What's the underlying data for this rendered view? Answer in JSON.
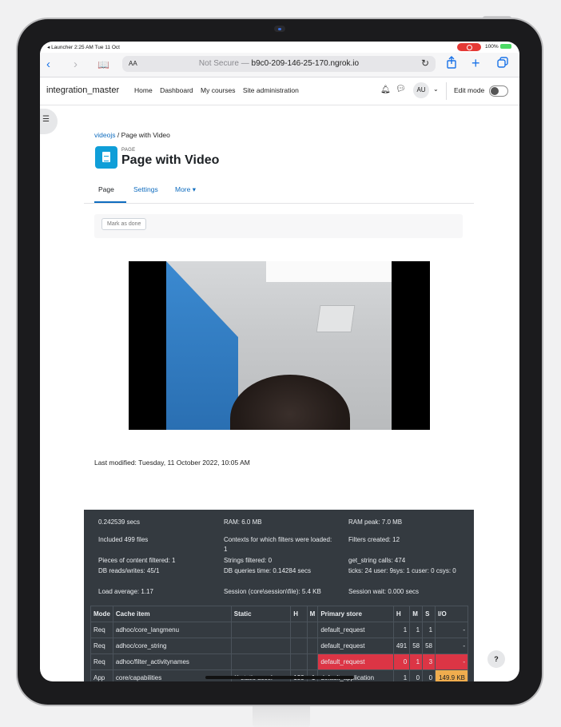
{
  "statusbar": {
    "time_info": "◂ Launcher  2:25 AM   Tue 11 Oct",
    "battery": "100%"
  },
  "browser": {
    "text_size": "AA",
    "not_secure": "Not Secure —",
    "host": "b9c0-209-146-25-170.ngrok.io",
    "icons": {
      "back": "chevron-left",
      "forward": "chevron-right",
      "bookmarks": "book",
      "reload": "refresh",
      "share": "share",
      "new_tab": "plus",
      "tabs": "tabs"
    }
  },
  "nav": {
    "site_name": "integration_master",
    "links": [
      "Home",
      "Dashboard",
      "My courses",
      "Site administration"
    ],
    "avatar_initials": "AU",
    "edit_mode": "Edit mode"
  },
  "breadcrumb": {
    "parent": "videojs",
    "separator": "/",
    "current": "Page with Video"
  },
  "page": {
    "kind": "PAGE",
    "title": "Page with Video",
    "tabs": {
      "page": "Page",
      "settings": "Settings",
      "more": "More ▾"
    },
    "mark_done": "Mark as done",
    "last_modified": "Last modified: Tuesday, 11 October 2022, 10:05 AM"
  },
  "perf": {
    "time": "0.242539 secs",
    "ram": "RAM: 6.0 MB",
    "ram_peak": "RAM peak: 7.0 MB",
    "included": "Included 499 files",
    "contexts": "Contexts for which filters were loaded: 1",
    "filters_created": "Filters created: 12",
    "pieces": "Pieces of content filtered: 1",
    "strings": "Strings filtered: 0",
    "get_string": "get_string calls: 474",
    "db_rw": "DB reads/writes: 45/1",
    "db_time": "DB queries time: 0.14284 secs",
    "ticks": "ticks: 24 user: 9sys: 1 cuser: 0 csys: 0",
    "load": "Load average: 1.17",
    "session": "Session (core\\session\\file): 5.4 KB",
    "session_wait": "Session wait: 0.000 secs"
  },
  "cache_table": {
    "headers": [
      "Mode",
      "Cache item",
      "Static",
      "H",
      "M",
      "Primary store",
      "H",
      "M",
      "S",
      "I/O"
    ],
    "rows": [
      [
        "Req",
        "adhoc/core_langmenu",
        "",
        "",
        "",
        "default_request",
        "1",
        "1",
        "1",
        "-"
      ],
      [
        "Req",
        "adhoc/core_string",
        "",
        "",
        "",
        "default_request",
        "491",
        "58",
        "58",
        "-"
      ],
      [
        "Req",
        "adhoc/filter_activitynames",
        "",
        "",
        "",
        "default_request",
        "0",
        "1",
        "3",
        "-"
      ],
      [
        "App",
        "core/capabilities",
        "** static accel",
        "139",
        "1",
        "default_application",
        "1",
        "0",
        "0",
        "149.9 KB"
      ]
    ]
  },
  "help_label": "?"
}
